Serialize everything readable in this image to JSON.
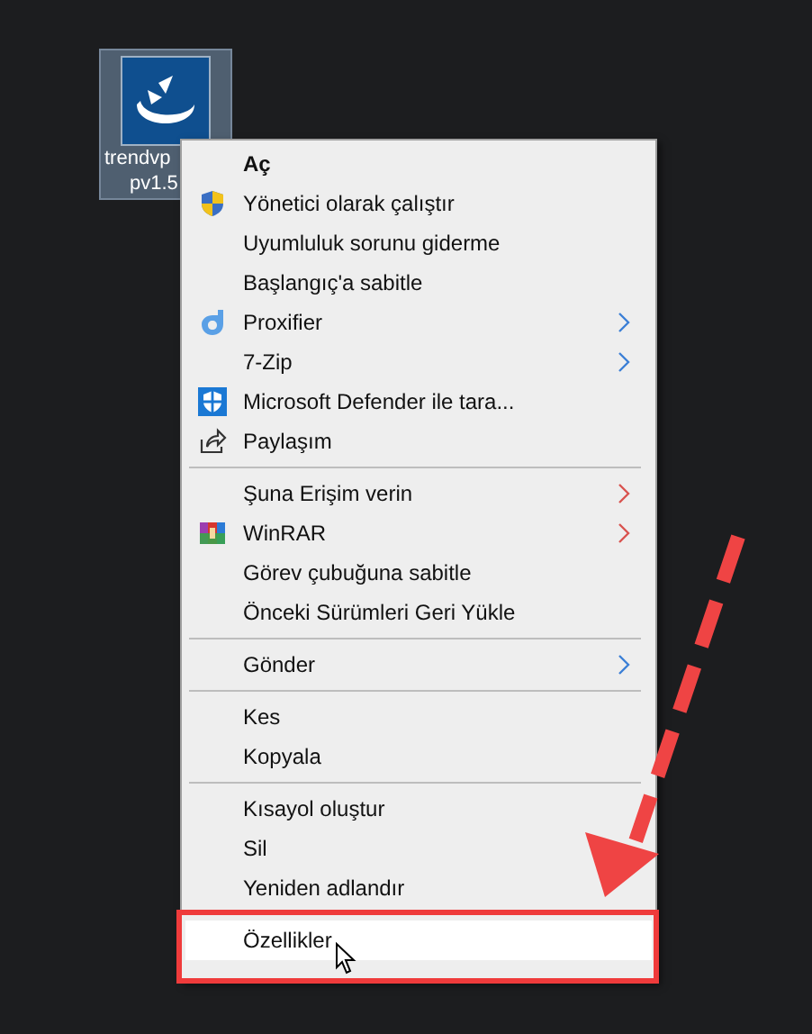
{
  "desktop_icon": {
    "label_lines": [
      "trendvp",
      "pv1.5"
    ],
    "selected": true
  },
  "context_menu": {
    "items": [
      {
        "kind": "plain",
        "label": "Aç",
        "bold": true,
        "selected": false
      },
      {
        "kind": "shield",
        "label": "Yönetici olarak çalıştır",
        "selected": false
      },
      {
        "kind": "plain",
        "label": "Uyumluluk sorunu giderme",
        "selected": false
      },
      {
        "kind": "plain",
        "label": "Başlangıç'a sabitle",
        "selected": false
      },
      {
        "kind": "proxifier",
        "label": "Proxifier",
        "submenu": true,
        "color": "#3b7fd6",
        "selected": false
      },
      {
        "kind": "plain",
        "label": "7-Zip",
        "submenu": true,
        "color": "#3b7fd6",
        "selected": false
      },
      {
        "kind": "defender",
        "label": "Microsoft Defender ile tara...",
        "selected": false
      },
      {
        "kind": "share",
        "label": "Paylaşım",
        "selected": false
      },
      {
        "kind": "separator"
      },
      {
        "kind": "plain",
        "label": "Şuna Erişim verin",
        "submenu": true,
        "color": "#d9534f",
        "selected": false
      },
      {
        "kind": "winrar",
        "label": "WinRAR",
        "submenu": true,
        "color": "#d9534f",
        "selected": false
      },
      {
        "kind": "plain",
        "label": "Görev çubuğuna sabitle",
        "selected": false
      },
      {
        "kind": "plain",
        "label": "Önceki Sürümleri Geri Yükle",
        "selected": false
      },
      {
        "kind": "separator"
      },
      {
        "kind": "plain",
        "label": "Gönder",
        "submenu": true,
        "color": "#3b7fd6",
        "selected": false
      },
      {
        "kind": "separator"
      },
      {
        "kind": "plain",
        "label": "Kes",
        "selected": false
      },
      {
        "kind": "plain",
        "label": "Kopyala",
        "selected": false
      },
      {
        "kind": "separator"
      },
      {
        "kind": "plain",
        "label": "Kısayol oluştur",
        "selected": false
      },
      {
        "kind": "plain",
        "label": "Sil",
        "selected": false
      },
      {
        "kind": "plain",
        "label": "Yeniden adlandır",
        "selected": false
      },
      {
        "kind": "separator"
      },
      {
        "kind": "plain",
        "label": "Özellikler",
        "selected": true
      }
    ]
  }
}
